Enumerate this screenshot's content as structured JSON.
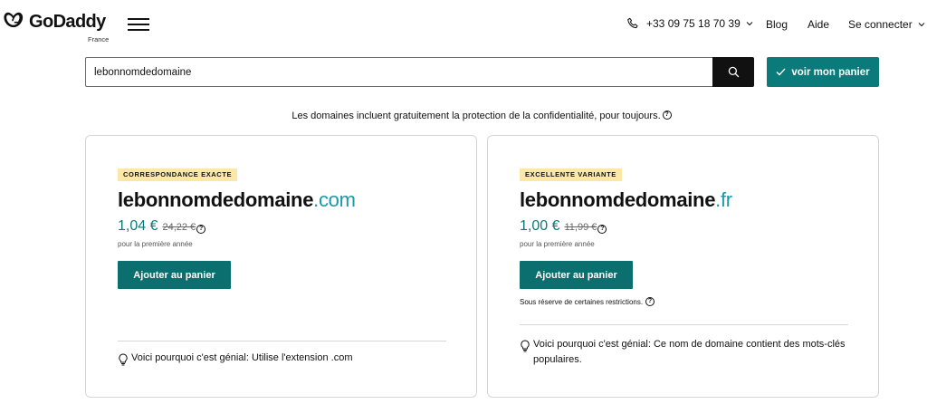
{
  "header": {
    "brand": "GoDaddy",
    "region": "France",
    "phone": "+33 09 75 18 70 39",
    "nav": {
      "blog": "Blog",
      "help": "Aide",
      "login": "Se connecter"
    }
  },
  "search": {
    "value": "lebonnomdedomaine",
    "cart_label": "voir mon panier"
  },
  "privacy_note": "Les domaines incluent gratuitement la protection de la confidentialité, pour toujours.",
  "results": [
    {
      "badge": "CORRESPONDANCE EXACTE",
      "name": "lebonnomdedomaine",
      "tld": ".com",
      "price": "1,04 €",
      "old_price": "24,22 €",
      "period": "pour la première année",
      "add_label": "Ajouter au panier",
      "why": "Voici pourquoi c'est génial: Utilise l'extension .com"
    },
    {
      "badge": "EXCELLENTE VARIANTE",
      "name": "lebonnomdedomaine",
      "tld": ".fr",
      "price": "1,00 €",
      "old_price": "11,99 €",
      "period": "pour la première année",
      "add_label": "Ajouter au panier",
      "restriction": "Sous réserve de certaines restrictions.",
      "why": "Voici pourquoi c'est génial: Ce nom de domaine contient des mots-clés populaires."
    }
  ],
  "colors": {
    "accent": "#0b7a7a",
    "tld": "#1a9aa8",
    "badge": "#fce8a4"
  },
  "icons": [
    "godaddy-logo-icon",
    "menu-icon",
    "phone-icon",
    "chevron-down-icon",
    "search-icon",
    "check-icon",
    "info-icon",
    "lightbulb-icon"
  ]
}
